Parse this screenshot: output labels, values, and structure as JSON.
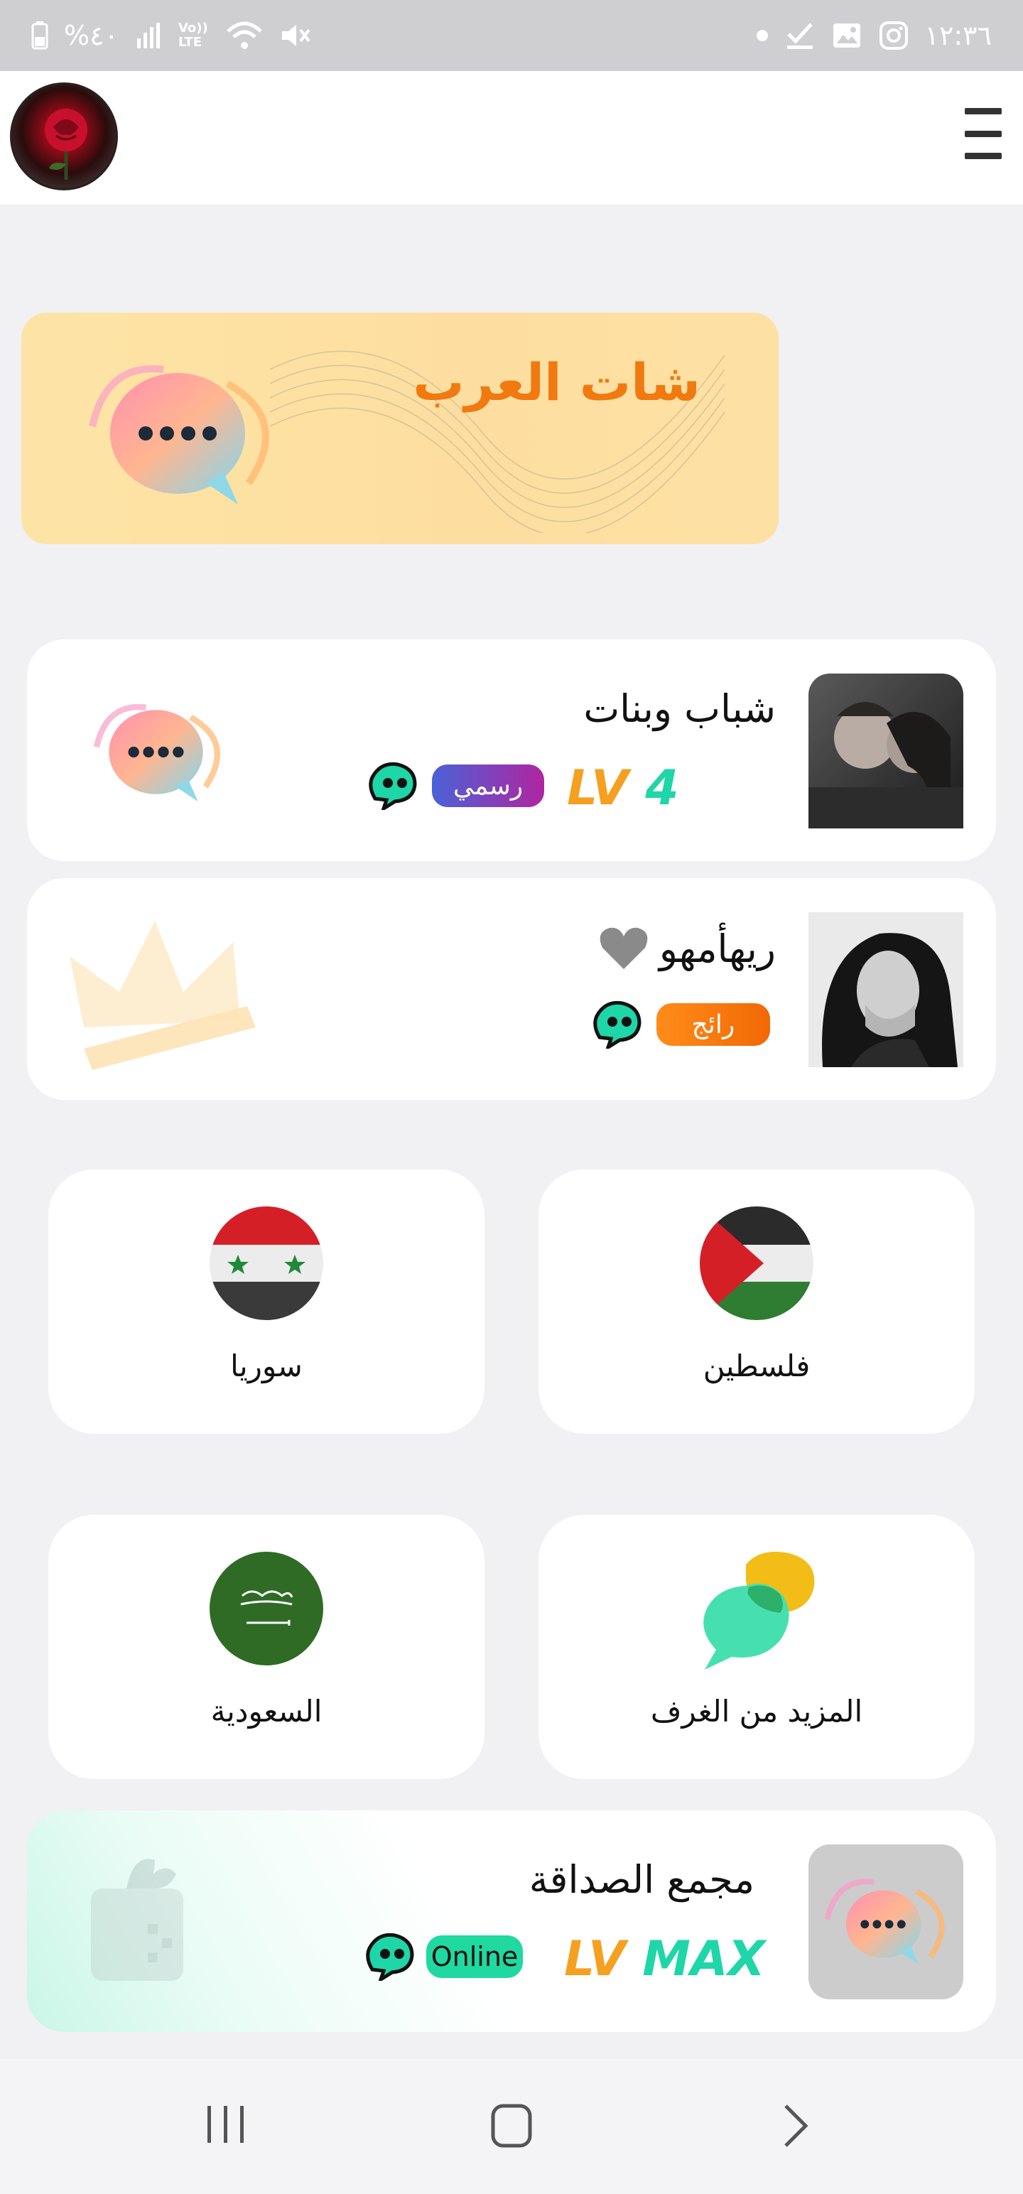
{
  "status_bar": {
    "battery_text": "%٤٠",
    "network_text": "Vo)) LTE",
    "time": "١٢:٣٦"
  },
  "header": {
    "menu_icon": "hamburger-menu-icon",
    "avatar_icon": "red-rose-avatar"
  },
  "banner": {
    "title": "شات العرب"
  },
  "rooms": [
    {
      "title": "شباب وبنات",
      "badge": "رسمي",
      "level_prefix": "LV",
      "level_value": "4",
      "badge_color": "#7a3fc6"
    },
    {
      "title": "ريهأمهو",
      "badge": "رائج",
      "badge_color": "#f8730a"
    },
    {
      "title": "مجمع الصداقة",
      "badge": "Online",
      "level_prefix": "LV",
      "level_value": "MAX",
      "badge_color": "#1fd9a0"
    }
  ],
  "countries": [
    {
      "name": "سوريا"
    },
    {
      "name": "فلسطين"
    },
    {
      "name": "السعودية"
    },
    {
      "name": "المزيد من الغرف"
    }
  ],
  "nav": {
    "recent_icon": "recent-apps-icon",
    "home_icon": "home-icon",
    "back_icon": "back-icon"
  }
}
